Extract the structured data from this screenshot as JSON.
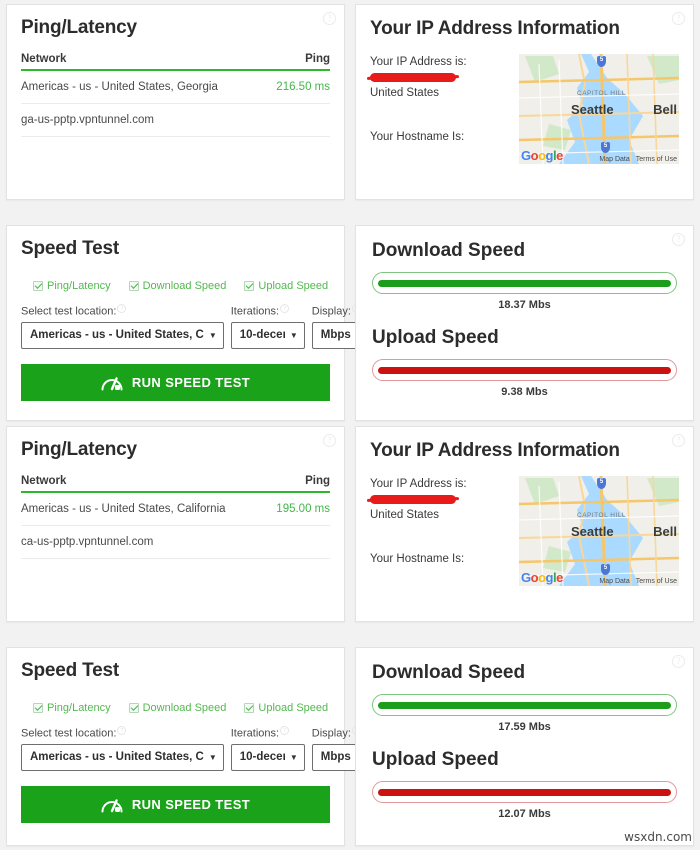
{
  "panels": {
    "ping1": {
      "title": "Ping/Latency",
      "col_network": "Network",
      "col_ping": "Ping",
      "network": "Americas - us - United States, Georgia",
      "ping": "216.50 ms",
      "hostname": "ga-us-pptp.vpntunnel.com",
      "help": "?"
    },
    "ip1": {
      "title": "Your IP Address Information",
      "ip_label": "Your IP Address is:",
      "country": "United States",
      "hostname_label": "Your Hostname Is:",
      "help": "?",
      "map": {
        "city": "Seattle",
        "city2": "Bell",
        "neighborhood": "CAPITOL HILL",
        "map_data": "Map Data",
        "terms": "Terms of Use",
        "highway": "5"
      }
    },
    "speedtest1": {
      "title": "Speed Test",
      "checkboxes": [
        {
          "label": "Ping/Latency",
          "checked": true
        },
        {
          "label": "Download Speed",
          "checked": true
        },
        {
          "label": "Upload Speed",
          "checked": true
        }
      ],
      "location_label": "Select test location:",
      "location_value": "Americas - us - United States, C",
      "iterations_label": "Iterations:",
      "iterations_value": "10-decen",
      "display_label": "Display:",
      "display_value": "Mbps",
      "run_button": "RUN SPEED TEST",
      "caret": "▼",
      "help_sup": "?"
    },
    "speeds1": {
      "download_title": "Download Speed",
      "download_value": "18.37 Mbs",
      "upload_title": "Upload Speed",
      "upload_value": "9.38 Mbs",
      "help": "?"
    },
    "ping2": {
      "title": "Ping/Latency",
      "col_network": "Network",
      "col_ping": "Ping",
      "network": "Americas - us - United States, California",
      "ping": "195.00 ms",
      "hostname": "ca-us-pptp.vpntunnel.com",
      "help": "?"
    },
    "ip2": {
      "title": "Your IP Address Information",
      "ip_label": "Your IP Address is:",
      "country": "United States",
      "hostname_label": "Your Hostname Is:",
      "help": "?",
      "map": {
        "city": "Seattle",
        "city2": "Bell",
        "neighborhood": "CAPITOL HILL",
        "map_data": "Map Data",
        "terms": "Terms of Use",
        "highway": "5"
      }
    },
    "speedtest2": {
      "title": "Speed Test",
      "checkboxes": [
        {
          "label": "Ping/Latency",
          "checked": true
        },
        {
          "label": "Download Speed",
          "checked": true
        },
        {
          "label": "Upload Speed",
          "checked": true
        }
      ],
      "location_label": "Select test location:",
      "location_value": "Americas - us - United States, C",
      "iterations_label": "Iterations:",
      "iterations_value": "10-decen",
      "display_label": "Display:",
      "display_value": "Mbps",
      "run_button": "RUN SPEED TEST",
      "caret": "▼",
      "help_sup": "?"
    },
    "speeds2": {
      "download_title": "Download Speed",
      "download_value": "17.59 Mbs",
      "upload_title": "Upload Speed",
      "upload_value": "12.07 Mbs",
      "help": "?"
    }
  },
  "watermark": "wsxdn.com",
  "colors": {
    "accent_green": "#43b649",
    "button_green": "#1aa31a",
    "download_bar": "#1c9e1c",
    "upload_bar": "#cc1111",
    "redaction_red": "#e81b1b",
    "page_bg": "#f2f2f2"
  }
}
